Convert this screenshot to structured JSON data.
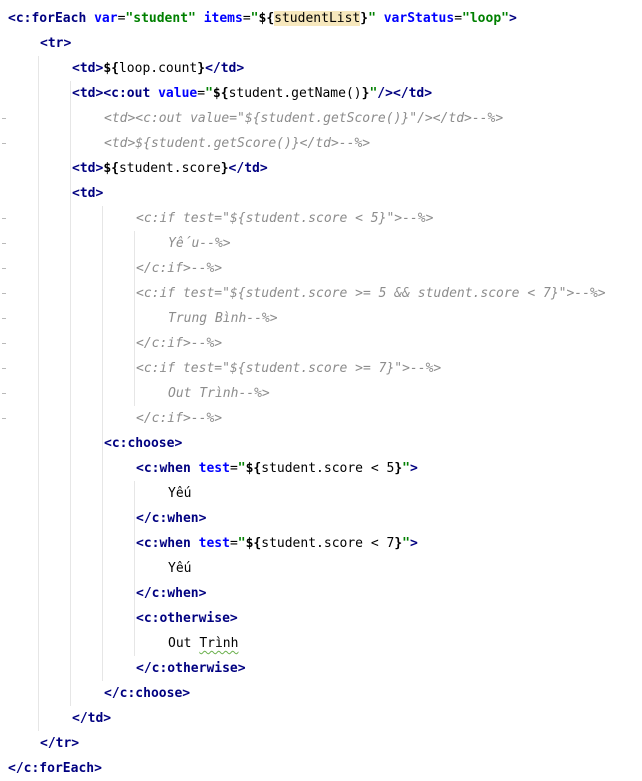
{
  "lines": [
    {
      "indent": 0,
      "fold": false,
      "tokens": [
        {
          "t": "<",
          "c": "tag"
        },
        {
          "t": "c:forEach",
          "c": "tag"
        },
        {
          "t": " ",
          "c": "txt"
        },
        {
          "t": "var",
          "c": "attr"
        },
        {
          "t": "=",
          "c": "txt"
        },
        {
          "t": "\"student\"",
          "c": "str"
        },
        {
          "t": " ",
          "c": "txt"
        },
        {
          "t": "items",
          "c": "attr"
        },
        {
          "t": "=",
          "c": "txt"
        },
        {
          "t": "\"",
          "c": "str"
        },
        {
          "t": "${",
          "c": "el"
        },
        {
          "t": "studentList",
          "c": "txt",
          "hl": true
        },
        {
          "t": "}",
          "c": "el"
        },
        {
          "t": "\"",
          "c": "str"
        },
        {
          "t": " ",
          "c": "txt"
        },
        {
          "t": "varStatus",
          "c": "attr"
        },
        {
          "t": "=",
          "c": "txt"
        },
        {
          "t": "\"loop\"",
          "c": "str"
        },
        {
          "t": ">",
          "c": "tag"
        }
      ]
    },
    {
      "indent": 1,
      "fold": false,
      "tokens": [
        {
          "t": "<tr>",
          "c": "tag"
        }
      ]
    },
    {
      "indent": 2,
      "fold": false,
      "tokens": [
        {
          "t": "<td>",
          "c": "tag"
        },
        {
          "t": "${",
          "c": "el"
        },
        {
          "t": "loop.count",
          "c": "txt"
        },
        {
          "t": "}",
          "c": "el"
        },
        {
          "t": "</td>",
          "c": "tag"
        }
      ]
    },
    {
      "indent": 2,
      "fold": false,
      "tokens": [
        {
          "t": "<td>",
          "c": "tag"
        },
        {
          "t": "<c:out",
          "c": "tag"
        },
        {
          "t": " ",
          "c": "txt"
        },
        {
          "t": "value",
          "c": "attr"
        },
        {
          "t": "=",
          "c": "txt"
        },
        {
          "t": "\"",
          "c": "str"
        },
        {
          "t": "${",
          "c": "el"
        },
        {
          "t": "student.getName()",
          "c": "txt"
        },
        {
          "t": "}",
          "c": "el"
        },
        {
          "t": "\"",
          "c": "str"
        },
        {
          "t": "/>",
          "c": "tag"
        },
        {
          "t": "</td>",
          "c": "tag"
        }
      ]
    },
    {
      "indent": 3,
      "fold": true,
      "tokens": [
        {
          "t": "<td><c:out value=\"${student.getScore()}\"/></td>--%>",
          "c": "cmt"
        }
      ]
    },
    {
      "indent": 3,
      "fold": true,
      "tokens": [
        {
          "t": "<td>${student.getScore()}</td>--%>",
          "c": "cmt"
        }
      ]
    },
    {
      "indent": 2,
      "fold": false,
      "tokens": [
        {
          "t": "<td>",
          "c": "tag"
        },
        {
          "t": "${",
          "c": "el"
        },
        {
          "t": "student.score",
          "c": "txt"
        },
        {
          "t": "}",
          "c": "el"
        },
        {
          "t": "</td>",
          "c": "tag"
        }
      ]
    },
    {
      "indent": 2,
      "fold": false,
      "tokens": [
        {
          "t": "<td>",
          "c": "tag"
        }
      ]
    },
    {
      "indent": 4,
      "fold": true,
      "tokens": [
        {
          "t": "<c:if test=\"${student.score < 5}\">--%>",
          "c": "cmt"
        }
      ]
    },
    {
      "indent": 5,
      "fold": true,
      "tokens": [
        {
          "t": "Yếu--%>",
          "c": "cmt"
        }
      ]
    },
    {
      "indent": 4,
      "fold": true,
      "tokens": [
        {
          "t": "</c:if>--%>",
          "c": "cmt"
        }
      ]
    },
    {
      "indent": 4,
      "fold": true,
      "tokens": [
        {
          "t": "<c:if test=\"${student.score >= 5 && student.score < 7}\">--%>",
          "c": "cmt"
        }
      ]
    },
    {
      "indent": 5,
      "fold": true,
      "tokens": [
        {
          "t": "Trung Bình--%>",
          "c": "cmt"
        }
      ]
    },
    {
      "indent": 4,
      "fold": true,
      "tokens": [
        {
          "t": "</c:if>--%>",
          "c": "cmt"
        }
      ]
    },
    {
      "indent": 4,
      "fold": true,
      "tokens": [
        {
          "t": "<c:if test=\"${student.score >= 7}\">--%>",
          "c": "cmt"
        }
      ]
    },
    {
      "indent": 5,
      "fold": true,
      "tokens": [
        {
          "t": "Out Trình--%>",
          "c": "cmt"
        }
      ]
    },
    {
      "indent": 4,
      "fold": true,
      "tokens": [
        {
          "t": "</c:if>--%>",
          "c": "cmt"
        }
      ]
    },
    {
      "indent": 3,
      "fold": false,
      "tokens": [
        {
          "t": "<c:choose>",
          "c": "tag"
        }
      ]
    },
    {
      "indent": 4,
      "fold": false,
      "tokens": [
        {
          "t": "<c:when",
          "c": "tag"
        },
        {
          "t": " ",
          "c": "txt"
        },
        {
          "t": "test",
          "c": "attr"
        },
        {
          "t": "=",
          "c": "txt"
        },
        {
          "t": "\"",
          "c": "str"
        },
        {
          "t": "${",
          "c": "el"
        },
        {
          "t": "student.score < 5",
          "c": "txt"
        },
        {
          "t": "}",
          "c": "el"
        },
        {
          "t": "\"",
          "c": "str"
        },
        {
          "t": ">",
          "c": "tag"
        }
      ]
    },
    {
      "indent": 5,
      "fold": false,
      "tokens": [
        {
          "t": "Yếu",
          "c": "txt"
        }
      ]
    },
    {
      "indent": 4,
      "fold": false,
      "tokens": [
        {
          "t": "</c:when>",
          "c": "tag"
        }
      ]
    },
    {
      "indent": 4,
      "fold": false,
      "tokens": [
        {
          "t": "<c:when",
          "c": "tag"
        },
        {
          "t": " ",
          "c": "txt"
        },
        {
          "t": "test",
          "c": "attr"
        },
        {
          "t": "=",
          "c": "txt"
        },
        {
          "t": "\"",
          "c": "str"
        },
        {
          "t": "${",
          "c": "el"
        },
        {
          "t": "student.score < 7",
          "c": "txt"
        },
        {
          "t": "}",
          "c": "el"
        },
        {
          "t": "\"",
          "c": "str"
        },
        {
          "t": ">",
          "c": "tag"
        }
      ]
    },
    {
      "indent": 5,
      "fold": false,
      "tokens": [
        {
          "t": "Yếu",
          "c": "txt"
        }
      ]
    },
    {
      "indent": 4,
      "fold": false,
      "tokens": [
        {
          "t": "</c:when>",
          "c": "tag"
        }
      ]
    },
    {
      "indent": 4,
      "fold": false,
      "tokens": [
        {
          "t": "<c:otherwise>",
          "c": "tag"
        }
      ]
    },
    {
      "indent": 5,
      "fold": false,
      "tokens": [
        {
          "t": "Out ",
          "c": "txt"
        },
        {
          "t": "Trình",
          "c": "txt",
          "squiggle": true
        }
      ]
    },
    {
      "indent": 4,
      "fold": false,
      "tokens": [
        {
          "t": "</c:otherwise>",
          "c": "tag"
        }
      ]
    },
    {
      "indent": 3,
      "fold": false,
      "tokens": [
        {
          "t": "</c:choose>",
          "c": "tag"
        }
      ]
    },
    {
      "indent": 2,
      "fold": false,
      "tokens": [
        {
          "t": "</td>",
          "c": "tag"
        }
      ]
    },
    {
      "indent": 1,
      "fold": false,
      "tokens": [
        {
          "t": "</tr>",
          "c": "tag"
        }
      ]
    },
    {
      "indent": 0,
      "fold": false,
      "tokens": [
        {
          "t": "</c:forEach>",
          "c": "tag"
        }
      ]
    }
  ]
}
